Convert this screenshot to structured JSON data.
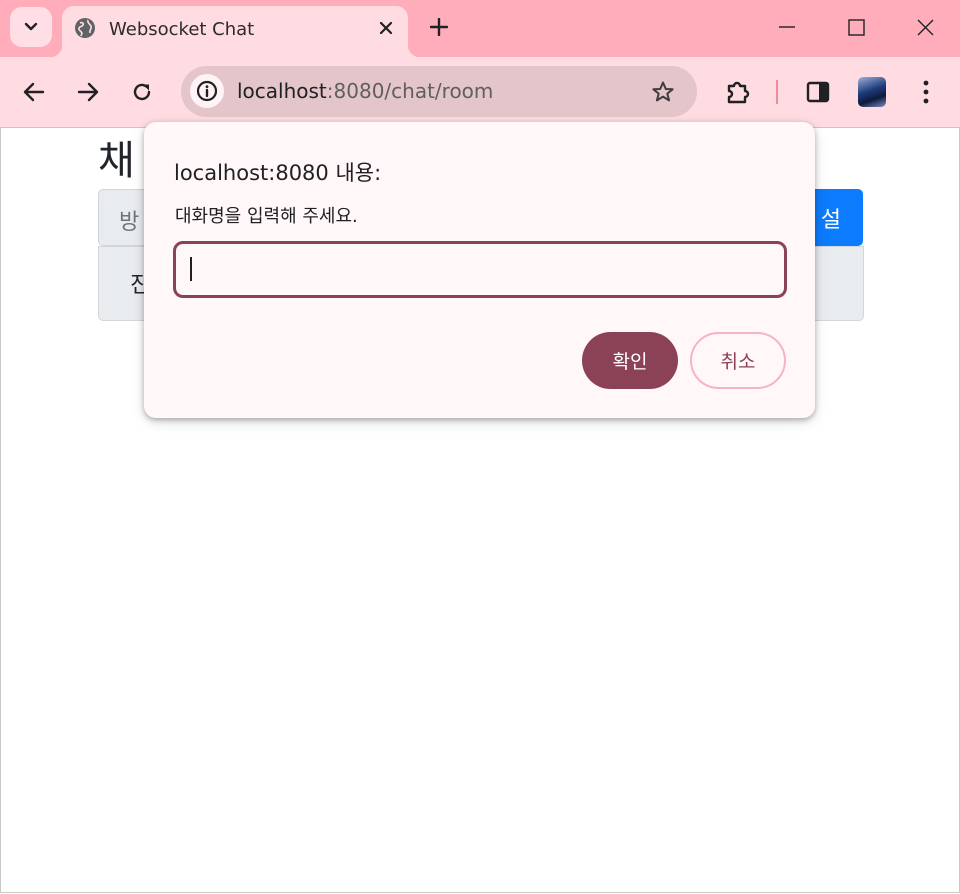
{
  "browser": {
    "tab_title": "Websocket Chat",
    "url_host": "localhost",
    "url_path": ":8080/chat/room",
    "icons": [
      "tab-search-icon",
      "globe-icon",
      "close-icon",
      "plus-icon",
      "minimize-icon",
      "maximize-icon",
      "window-close-icon",
      "back-icon",
      "forward-icon",
      "reload-icon",
      "info-icon",
      "star-icon",
      "extensions-icon",
      "side-panel-icon",
      "profile-avatar",
      "more-menu-icon"
    ]
  },
  "page": {
    "title_visible": "채",
    "room_input_visible": "방",
    "create_button_visible": "설",
    "list_item_visible": "진"
  },
  "dialog": {
    "title": "localhost:8080 내용:",
    "message": "대화명을 입력해 주세요.",
    "input_value": "",
    "ok_label": "확인",
    "cancel_label": "취소"
  },
  "colors": {
    "tab_strip": "#ffadbb",
    "toolbar": "#ffdce2",
    "dialog_accent": "#8b4257",
    "primary_button": "#0d7bfd"
  }
}
